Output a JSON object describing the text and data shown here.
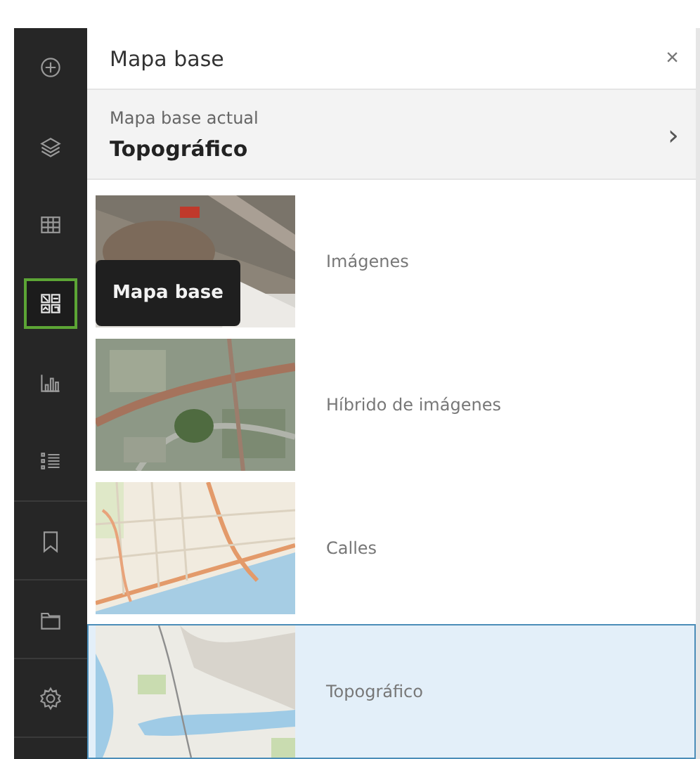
{
  "sidebar": {
    "items": [
      {
        "selected": false
      },
      {
        "selected": false
      },
      {
        "selected": false
      },
      {
        "selected": true
      },
      {
        "selected": false
      },
      {
        "selected": false
      },
      {
        "selected": false
      },
      {
        "selected": false
      },
      {
        "selected": false
      }
    ],
    "tooltip": "Mapa base"
  },
  "panel": {
    "title": "Mapa base",
    "close": "×",
    "current": {
      "label": "Mapa base actual",
      "value": "Topográfico",
      "chevron": "›"
    },
    "basemaps": [
      {
        "label": "Imágenes",
        "selected": false
      },
      {
        "label": "Híbrido de imágenes",
        "selected": false
      },
      {
        "label": "Calles",
        "selected": false
      },
      {
        "label": "Topográfico",
        "selected": true
      }
    ]
  }
}
